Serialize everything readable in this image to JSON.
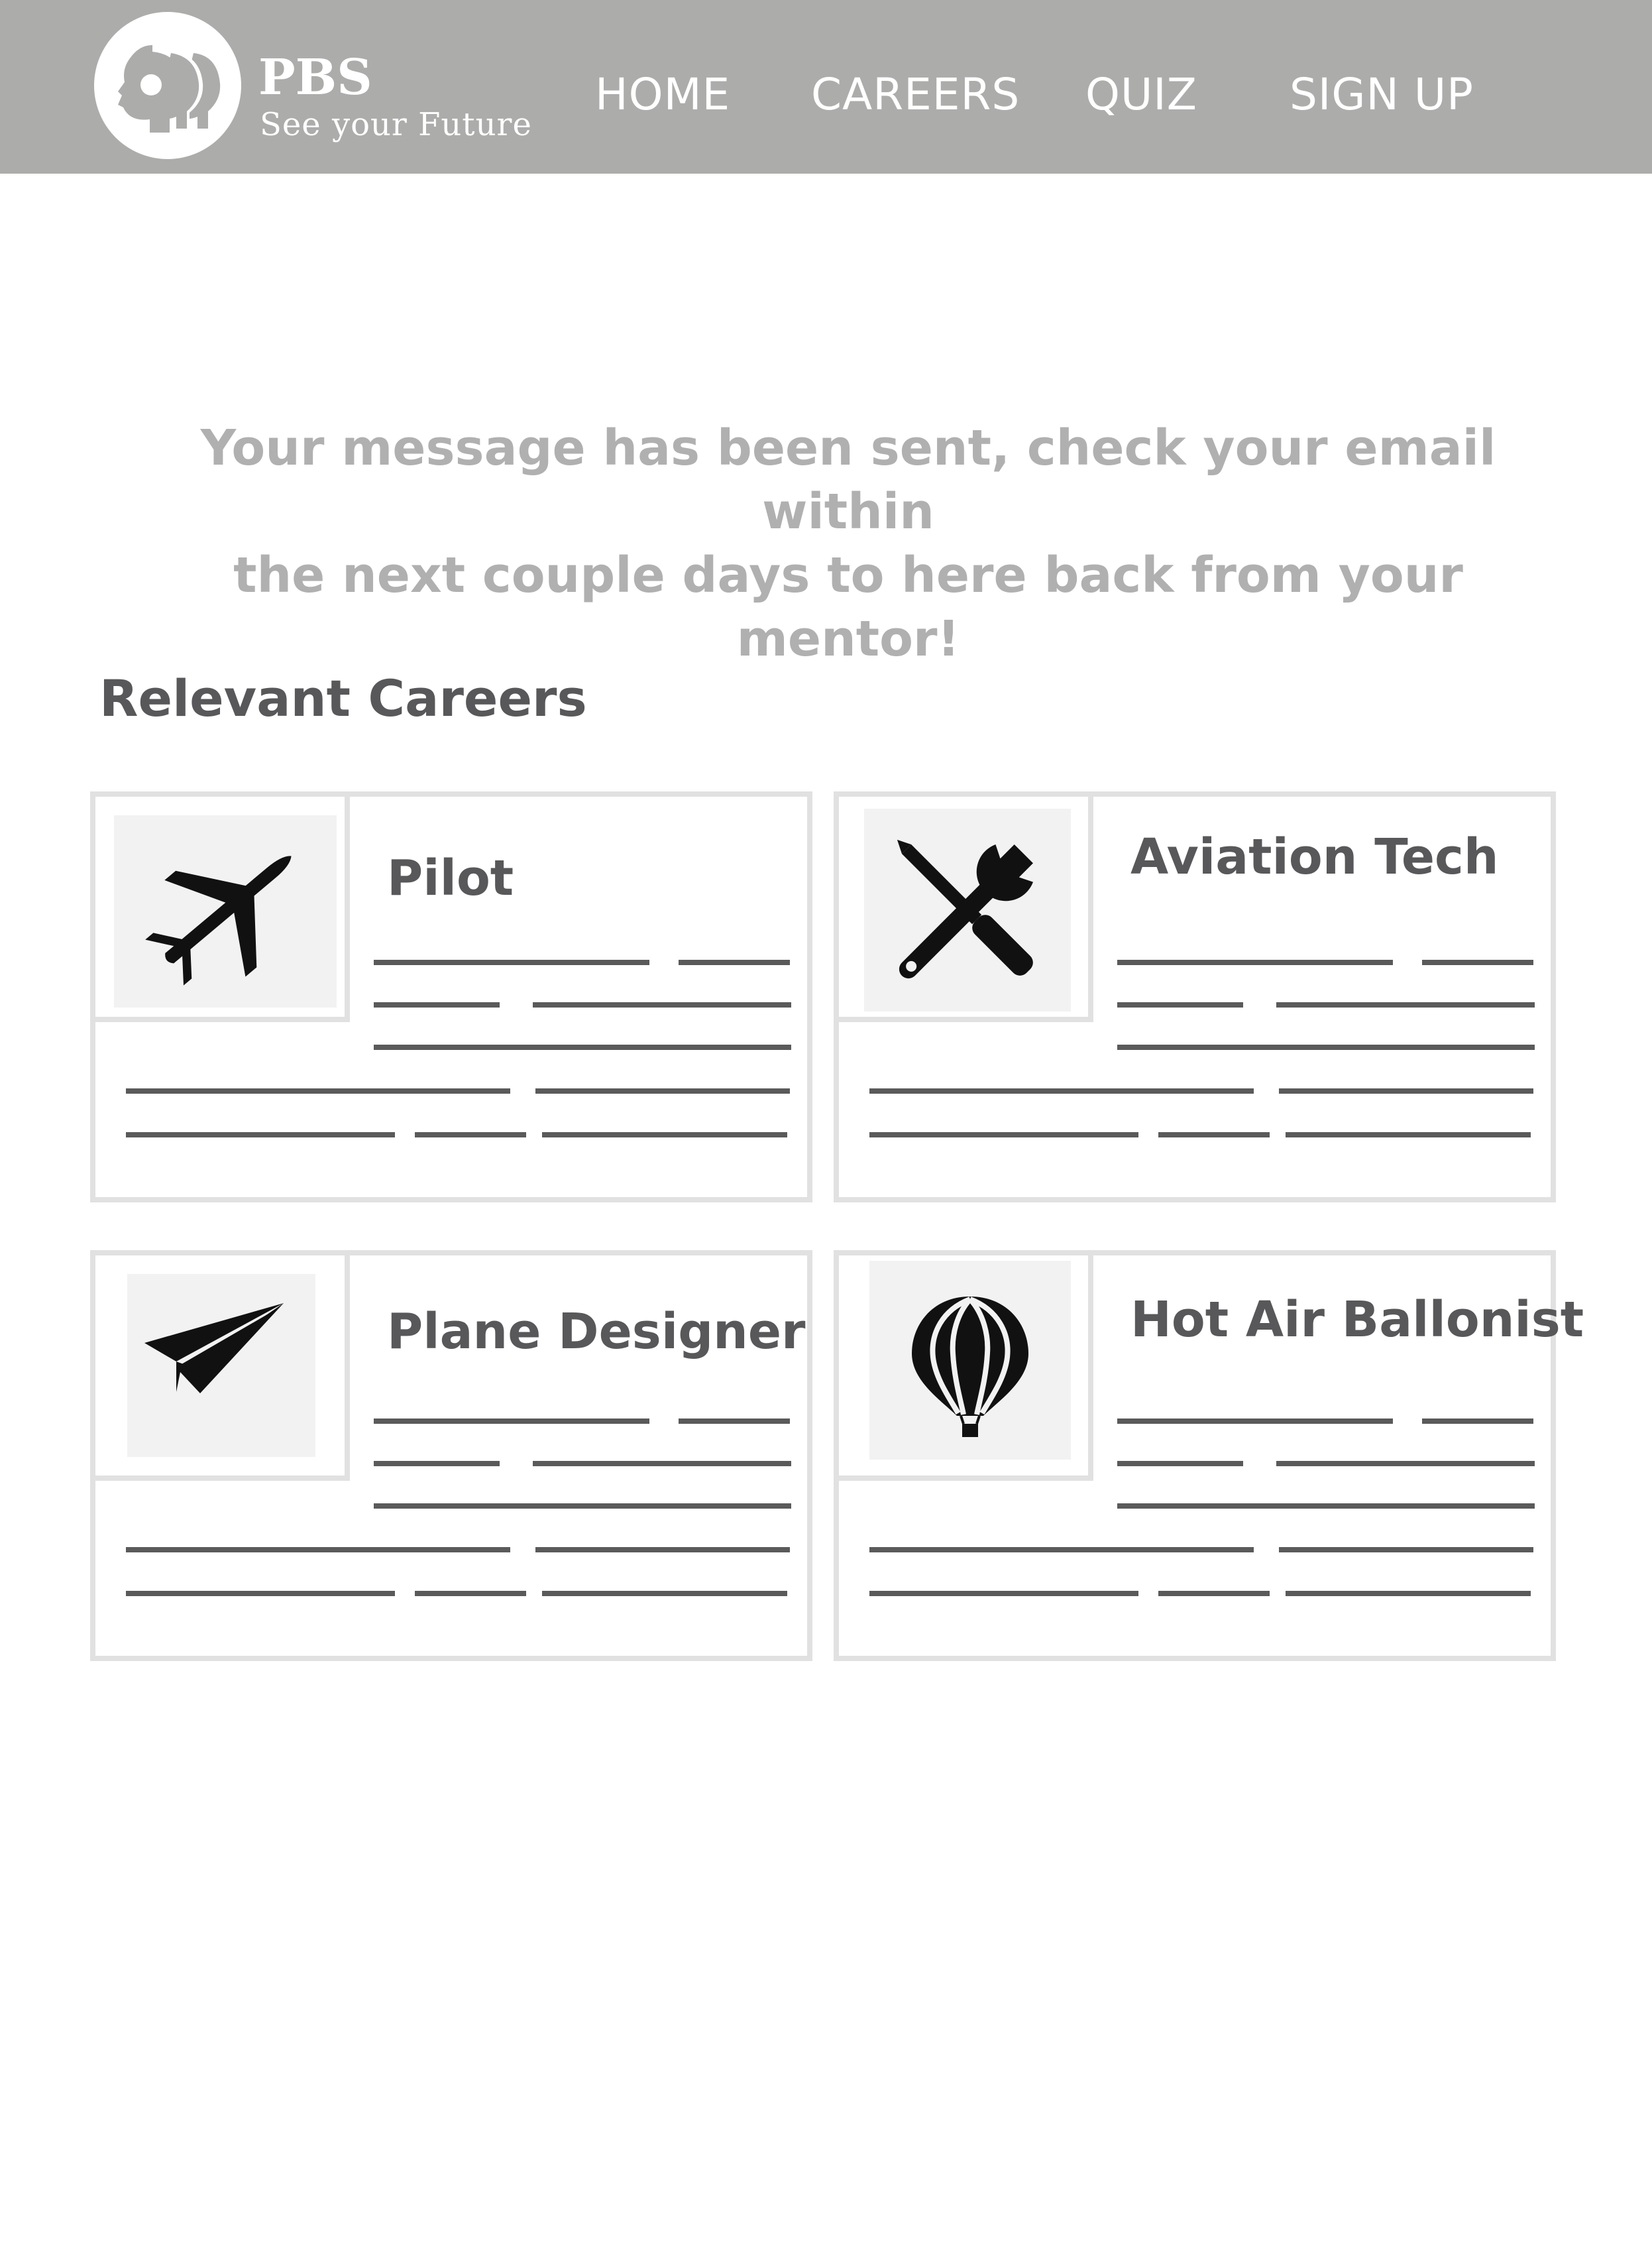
{
  "header": {
    "brand_name": "PBS",
    "brand_tagline": "See your Future",
    "nav": [
      "HOME",
      "CAREERS",
      "QUIZ",
      "SIGN UP"
    ]
  },
  "confirmation": {
    "line1": "Your message has been sent, check your email within",
    "line2": "the next couple days to here back from your mentor!"
  },
  "careers": {
    "heading": "Relevant Careers",
    "items": [
      {
        "title": "Pilot",
        "icon": "airplane-icon"
      },
      {
        "title": "Aviation Tech",
        "icon": "wrench-screwdriver-icon"
      },
      {
        "title": "Plane Designer",
        "icon": "paper-plane-icon"
      },
      {
        "title": "Hot Air Ballonist",
        "icon": "hot-air-balloon-icon"
      }
    ]
  },
  "colors": {
    "header_bg": "#acacab",
    "text_dark": "#58585a",
    "text_muted": "#b0b0b0",
    "card_border": "#e1e1e1"
  }
}
